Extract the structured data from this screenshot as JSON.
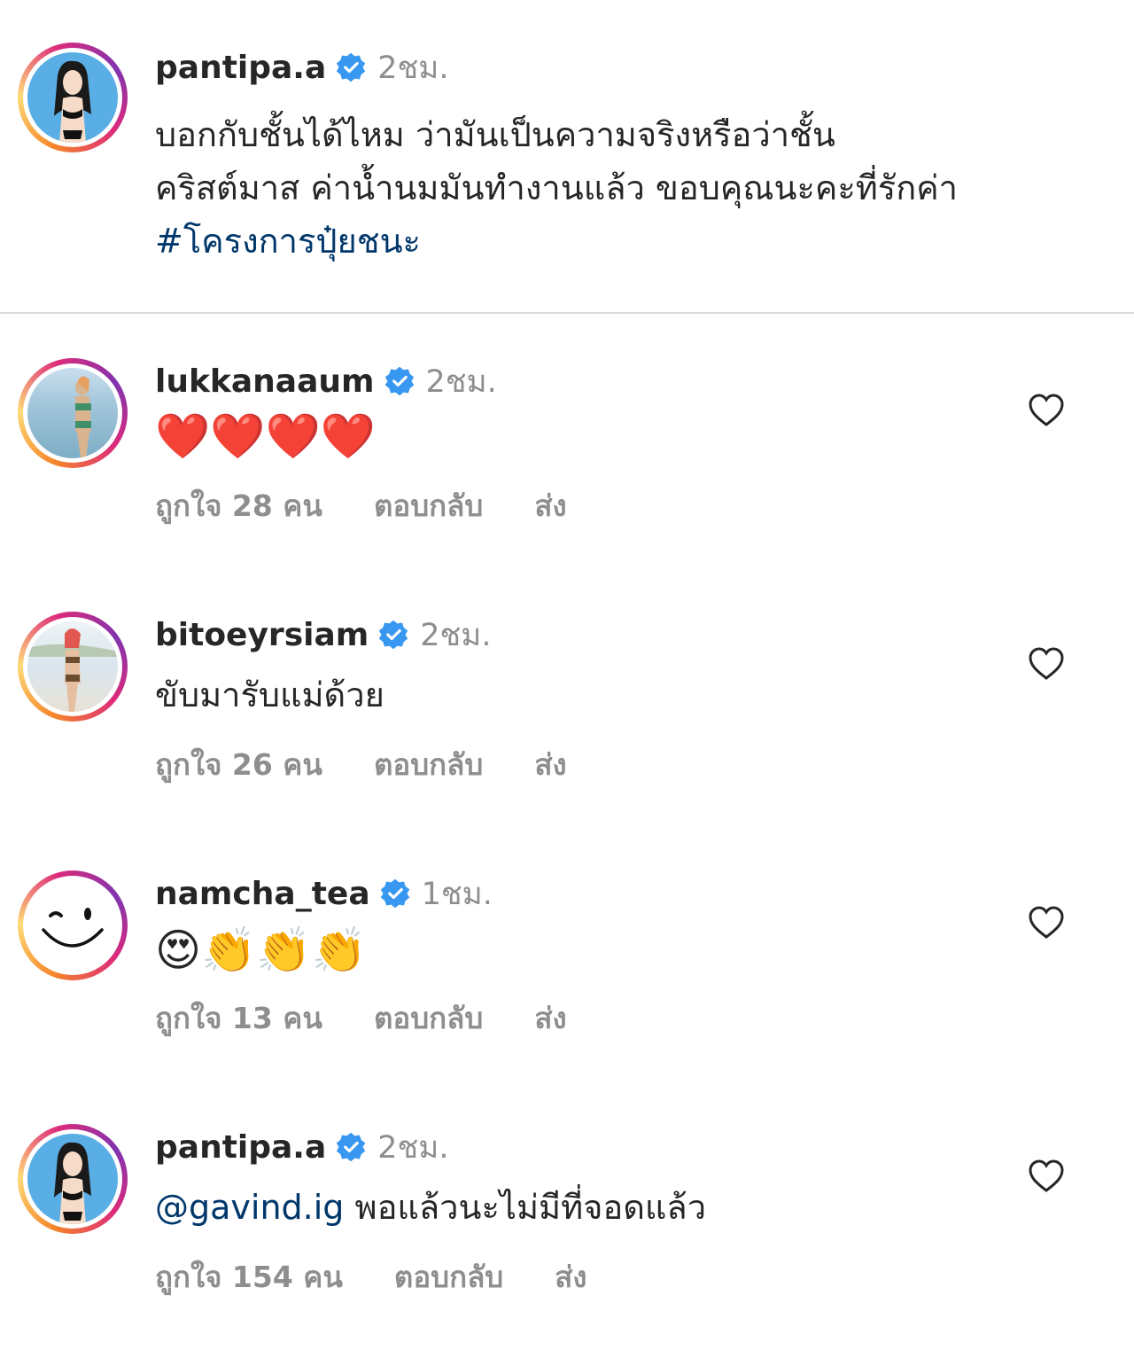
{
  "caption": {
    "username": "pantipa.a",
    "time": "2ชม.",
    "lines": [
      "บอกกับชั้นได้ไหม ว่ามันเป็นความจริงหรือว่าชั้น",
      "คริสต์มาส ค่าน้ำนมมันทำงานแล้ว ขอบคุณนะคะที่รักค่า"
    ],
    "hashtag": "#โครงการปุ๋ยชนะ"
  },
  "comments": [
    {
      "username": "lukkanaaum",
      "time": "2ชม.",
      "text": "❤️❤️❤️❤️",
      "likes": "ถูกใจ 28 คน",
      "reply": "ตอบกลับ",
      "send": "ส่ง"
    },
    {
      "username": "bitoeyrsiam",
      "time": "2ชม.",
      "text": "ขับมารับแม่ด้วย",
      "likes": "ถูกใจ 26 คน",
      "reply": "ตอบกลับ",
      "send": "ส่ง"
    },
    {
      "username": "namcha_tea",
      "time": "1ชม.",
      "text": "😍👏👏👏",
      "likes": "ถูกใจ 13 คน",
      "reply": "ตอบกลับ",
      "send": "ส่ง"
    },
    {
      "username": "pantipa.a",
      "time": "2ชม.",
      "mention": "@gavind.ig",
      "text": "พอแล้วนะไม่มีที่จอดแล้ว",
      "likes": "ถูกใจ 154 คน",
      "reply": "ตอบกลับ",
      "send": "ส่ง"
    }
  ],
  "icons": {
    "verified": "verified-badge-icon",
    "like": "heart-outline-icon"
  },
  "colors": {
    "verified": "#3897f0",
    "link": "#00376b",
    "muted": "#8e8e8e",
    "text": "#262626"
  }
}
